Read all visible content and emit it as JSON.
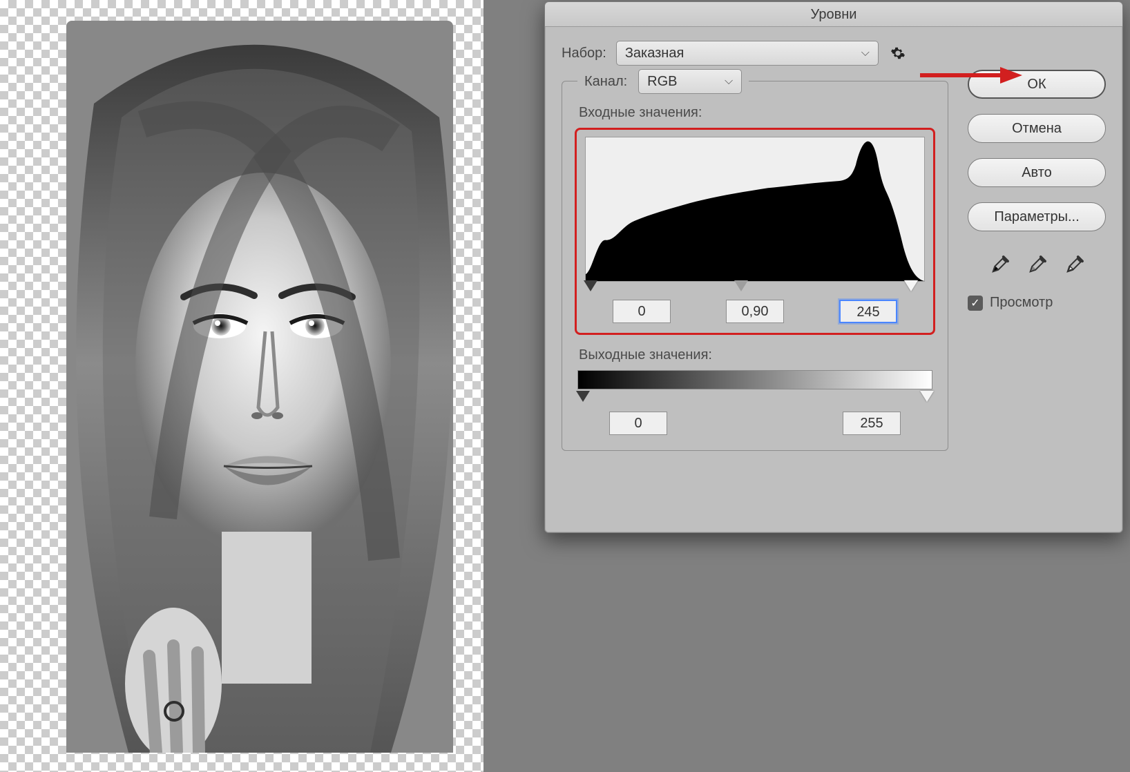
{
  "dialog": {
    "title": "Уровни",
    "preset_label": "Набор:",
    "preset_value": "Заказная",
    "channel_label": "Канал:",
    "channel_value": "RGB",
    "input_label": "Входные значения:",
    "output_label": "Выходные значения:",
    "input_black": "0",
    "input_gamma": "0,90",
    "input_white": "245",
    "output_black": "0",
    "output_white": "255"
  },
  "buttons": {
    "ok": "ОК",
    "cancel": "Отмена",
    "auto": "Авто",
    "options": "Параметры..."
  },
  "preview_label": "Просмотр",
  "preview_checked": true
}
